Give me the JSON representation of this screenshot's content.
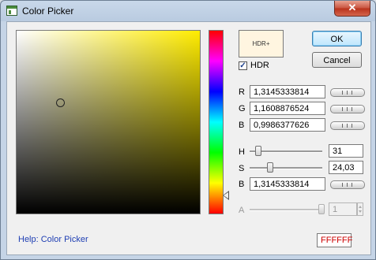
{
  "window": {
    "title": "Color Picker",
    "close_glyph": "✕"
  },
  "preview": {
    "label": "HDR+"
  },
  "hdr": {
    "label": "HDR",
    "checked": true
  },
  "buttons": {
    "ok": "OK",
    "cancel": "Cancel"
  },
  "rgb": [
    {
      "label": "R",
      "value": "1,3145333814"
    },
    {
      "label": "G",
      "value": "1,1608876524"
    },
    {
      "label": "B",
      "value": "0,9986377626"
    }
  ],
  "hsb": {
    "h": {
      "label": "H",
      "value": "31"
    },
    "s": {
      "label": "S",
      "value": "24,03"
    },
    "b": {
      "label": "B",
      "value": "1,3145333814"
    }
  },
  "alpha": {
    "label": "A",
    "value": "1"
  },
  "help_link": "Help: Color Picker",
  "hex_value": "FFFFFF",
  "icons": [
    "app-icon",
    "close-icon",
    "hue-marker-icon",
    "check-icon"
  ],
  "colors": {
    "hex_text": "#cc0000",
    "help_link": "#1f3fb3",
    "hue_top": "#ff0000"
  }
}
